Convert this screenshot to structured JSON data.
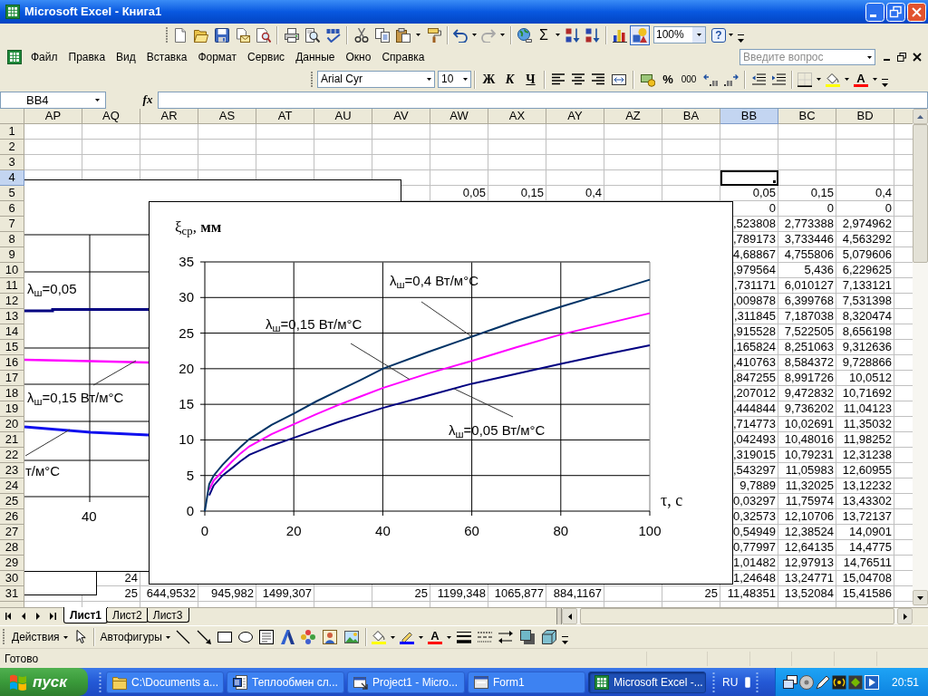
{
  "window": {
    "title": "Microsoft Excel - Книга1"
  },
  "standard_toolbar": {
    "autosum": "Σ",
    "zoom": "100%",
    "help": "?",
    "drawing_button": {
      "on": true
    }
  },
  "menu": [
    "Файл",
    "Правка",
    "Вид",
    "Вставка",
    "Формат",
    "Сервис",
    "Данные",
    "Окно",
    "Справка"
  ],
  "help_box": {
    "placeholder": "Введите вопрос"
  },
  "formatting_toolbar": {
    "font": "Arial Cyr",
    "size": "10",
    "bold": "Ж",
    "italic": "К",
    "underline": "Ч",
    "percent": "%",
    "thousands": "000",
    "font_color": "A"
  },
  "formula_bar": {
    "name_box": "BB4",
    "function_label": "fx"
  },
  "sheet": {
    "columns": [
      {
        "label": "AP",
        "selected": false
      },
      {
        "label": "AQ",
        "selected": false
      },
      {
        "label": "AR",
        "selected": false
      },
      {
        "label": "AS",
        "selected": false
      },
      {
        "label": "AT",
        "selected": false
      },
      {
        "label": "AU",
        "selected": false
      },
      {
        "label": "AV",
        "selected": false
      },
      {
        "label": "AW",
        "selected": false
      },
      {
        "label": "AX",
        "selected": false
      },
      {
        "label": "AY",
        "selected": false
      },
      {
        "label": "AZ",
        "selected": false
      },
      {
        "label": "BA",
        "selected": false
      },
      {
        "label": "BB",
        "selected": true
      },
      {
        "label": "BC",
        "selected": false
      },
      {
        "label": "BD",
        "selected": false
      }
    ],
    "rows": [
      {
        "label": "1",
        "selected": false
      },
      {
        "label": "2",
        "selected": false
      },
      {
        "label": "3",
        "selected": false
      },
      {
        "label": "4",
        "selected": true
      },
      {
        "label": "5",
        "selected": false,
        "cells": [
          null,
          null,
          null,
          null,
          null,
          null,
          null,
          "0,05",
          "0,15",
          "0,4",
          null,
          null,
          "0,05",
          "0,15",
          "0,4"
        ]
      },
      {
        "label": "6",
        "selected": false,
        "cells": [
          null,
          null,
          null,
          null,
          null,
          null,
          null,
          null,
          null,
          null,
          null,
          null,
          "0",
          "0",
          "0"
        ]
      },
      {
        "label": "7",
        "selected": false,
        "cells": [
          null,
          null,
          null,
          null,
          null,
          null,
          null,
          null,
          null,
          null,
          null,
          null,
          ",523808",
          "2,773388",
          "2,974962"
        ]
      },
      {
        "label": "8",
        "selected": false,
        "cells": [
          null,
          null,
          null,
          null,
          null,
          null,
          null,
          null,
          null,
          null,
          null,
          null,
          ",789173",
          "3,733446",
          "4,563292"
        ]
      },
      {
        "label": "9",
        "selected": false,
        "cells": [
          null,
          null,
          null,
          null,
          null,
          null,
          null,
          null,
          null,
          null,
          null,
          null,
          "4,68867",
          "4,755806",
          "5,079606"
        ]
      },
      {
        "label": "10",
        "selected": false,
        "cells": [
          null,
          null,
          null,
          null,
          null,
          null,
          null,
          null,
          null,
          null,
          null,
          null,
          ",979564",
          "5,436",
          "6,229625"
        ]
      },
      {
        "label": "11",
        "selected": false,
        "cells": [
          null,
          null,
          null,
          null,
          null,
          null,
          null,
          null,
          null,
          null,
          null,
          null,
          ",731171",
          "6,010127",
          "7,133121"
        ]
      },
      {
        "label": "12",
        "selected": false,
        "cells": [
          null,
          null,
          null,
          null,
          null,
          null,
          null,
          null,
          null,
          null,
          null,
          null,
          ",009878",
          "6,399768",
          "7,531398"
        ]
      },
      {
        "label": "13",
        "selected": false,
        "cells": [
          null,
          null,
          null,
          null,
          null,
          null,
          null,
          null,
          null,
          null,
          null,
          null,
          ",311845",
          "7,187038",
          "8,320474"
        ]
      },
      {
        "label": "14",
        "selected": false,
        "cells": [
          null,
          null,
          null,
          null,
          null,
          null,
          null,
          null,
          null,
          null,
          null,
          null,
          ",915528",
          "7,522505",
          "8,656198"
        ]
      },
      {
        "label": "15",
        "selected": false,
        "cells": [
          null,
          null,
          null,
          null,
          null,
          null,
          null,
          null,
          null,
          null,
          null,
          null,
          ",165824",
          "8,251063",
          "9,312636"
        ]
      },
      {
        "label": "16",
        "selected": false,
        "cells": [
          null,
          null,
          null,
          null,
          null,
          null,
          null,
          null,
          null,
          null,
          null,
          null,
          ",410763",
          "8,584372",
          "9,728866"
        ]
      },
      {
        "label": "17",
        "selected": false,
        "cells": [
          null,
          null,
          null,
          null,
          null,
          null,
          null,
          null,
          null,
          null,
          null,
          null,
          ",847255",
          "8,991726",
          "10,0512"
        ]
      },
      {
        "label": "18",
        "selected": false,
        "cells": [
          null,
          null,
          null,
          null,
          null,
          null,
          null,
          null,
          null,
          null,
          null,
          null,
          ",207012",
          "9,472832",
          "10,71692"
        ]
      },
      {
        "label": "19",
        "selected": false,
        "cells": [
          null,
          null,
          null,
          null,
          null,
          null,
          null,
          null,
          null,
          null,
          null,
          null,
          ",444844",
          "9,736202",
          "11,04123"
        ]
      },
      {
        "label": "20",
        "selected": false,
        "cells": [
          null,
          null,
          null,
          null,
          null,
          null,
          null,
          null,
          null,
          null,
          null,
          null,
          ",714773",
          "10,02691",
          "11,35032"
        ]
      },
      {
        "label": "21",
        "selected": false,
        "cells": [
          null,
          null,
          null,
          null,
          null,
          null,
          null,
          null,
          null,
          null,
          null,
          null,
          ",042493",
          "10,48016",
          "11,98252"
        ]
      },
      {
        "label": "22",
        "selected": false,
        "cells": [
          null,
          null,
          null,
          null,
          null,
          null,
          null,
          null,
          null,
          null,
          null,
          null,
          ",319015",
          "10,79231",
          "12,31238"
        ]
      },
      {
        "label": "23",
        "selected": false,
        "cells": [
          null,
          null,
          null,
          null,
          null,
          null,
          null,
          null,
          null,
          null,
          null,
          null,
          ",543297",
          "11,05983",
          "12,60955"
        ]
      },
      {
        "label": "24",
        "selected": false,
        "cells": [
          null,
          null,
          null,
          null,
          null,
          null,
          null,
          null,
          null,
          null,
          null,
          null,
          "9,7889",
          "11,32025",
          "13,12232"
        ]
      },
      {
        "label": "25",
        "selected": false,
        "cells": [
          null,
          null,
          null,
          null,
          null,
          null,
          null,
          null,
          null,
          null,
          null,
          null,
          "0,03297",
          "11,75974",
          "13,43302"
        ]
      },
      {
        "label": "26",
        "selected": false,
        "cells": [
          null,
          null,
          null,
          null,
          null,
          null,
          null,
          null,
          null,
          null,
          null,
          null,
          "0,32573",
          "12,10706",
          "13,72137"
        ]
      },
      {
        "label": "27",
        "selected": false,
        "cells": [
          null,
          null,
          null,
          null,
          null,
          null,
          null,
          null,
          null,
          null,
          null,
          null,
          "0,54949",
          "12,38524",
          "14,0901"
        ]
      },
      {
        "label": "28",
        "selected": false,
        "cells": [
          null,
          null,
          null,
          null,
          null,
          null,
          null,
          null,
          null,
          null,
          null,
          null,
          "0,77997",
          "12,64135",
          "14,4775"
        ]
      },
      {
        "label": "29",
        "selected": false,
        "cells": [
          null,
          null,
          null,
          null,
          null,
          null,
          null,
          null,
          null,
          null,
          null,
          null,
          "1,01482",
          "12,97913",
          "14,76511"
        ]
      },
      {
        "label": "30",
        "selected": false,
        "cells": [
          null,
          "24",
          null,
          null,
          null,
          null,
          null,
          null,
          null,
          null,
          null,
          null,
          "1,24648",
          "13,24771",
          "15,04708"
        ]
      },
      {
        "label": "31",
        "selected": false,
        "cells": [
          null,
          "25",
          "644,9532",
          "945,982",
          "1499,307",
          null,
          "25",
          "1199,348",
          "1065,877",
          "884,1167",
          null,
          "25",
          "11,48351",
          "13,52084",
          "15,41586"
        ]
      }
    ]
  },
  "background_chart": {
    "labels": [
      "λ$_{ш}$=0,05",
      "λ$_{ш}$=0,15 Вт/м°С",
      "т/м°С"
    ],
    "tick_label": "40"
  },
  "chart": {
    "chart_data": {
      "type": "line",
      "xlabel": "τ, с",
      "ylabel": "ξ$_{ср}$, **мм**",
      "x": [
        0,
        1,
        2,
        4,
        6,
        8,
        10,
        15,
        20,
        25,
        30,
        35,
        40,
        50,
        60,
        70,
        80,
        90,
        100
      ],
      "series": [
        {
          "color": "#000080",
          "values": [
            null,
            2.2,
            3.6,
            5.0,
            6.0,
            7.0,
            7.9,
            9.2,
            10.3,
            11.4,
            12.5,
            13.5,
            14.5,
            16.2,
            17.9,
            19.3,
            20.7,
            22.0,
            23.3
          ]
        },
        {
          "color": "#ff00ff",
          "values": [
            null,
            3.0,
            4.3,
            5.6,
            6.9,
            8.1,
            9.1,
            10.8,
            12.2,
            13.6,
            14.9,
            16.1,
            17.3,
            19.3,
            21.1,
            23.0,
            24.8,
            26.3,
            27.8
          ]
        },
        {
          "color": "#003366",
          "values": [
            0,
            3.8,
            5.0,
            6.5,
            7.8,
            9.0,
            10.1,
            12.1,
            13.7,
            15.4,
            16.9,
            18.4,
            20.0,
            22.3,
            24.5,
            26.7,
            28.7,
            30.6,
            32.5
          ]
        }
      ],
      "xlim": [
        0,
        100
      ],
      "ylim": [
        0,
        35
      ],
      "xticks": [
        0,
        20,
        40,
        60,
        80,
        100
      ],
      "yticks": [
        0,
        5,
        10,
        15,
        20,
        25,
        30,
        35
      ],
      "grid": true,
      "annotations": [
        {
          "text": "λ$_{ш}$=0,4 Вт/м°С",
          "x": 60,
          "y": 24.5
        },
        {
          "text": "λ$_{ш}$=0,15 Вт/м°С",
          "x": 46,
          "y": 18.5
        },
        {
          "text": "λ$_{ш}$=0,05 Вт/м°С",
          "x": 56,
          "y": 17.2
        }
      ]
    }
  },
  "sheet_tabs": [
    {
      "label": "Лист1",
      "selected": true
    },
    {
      "label": "Лист2",
      "selected": false
    },
    {
      "label": "Лист3",
      "selected": false
    }
  ],
  "drawing_toolbar": {
    "actions": "Действия",
    "autoshapes": "Автофигуры",
    "font_color": "A"
  },
  "status_bar": {
    "text": "Готово"
  },
  "taskbar": {
    "start": "пуск",
    "tasks": [
      {
        "label": "C:\\Documents a...",
        "kind": "folder",
        "selected": false
      },
      {
        "label": "Теплообмен сл...",
        "kind": "document",
        "selected": false
      },
      {
        "label": "Project1 - Micro...",
        "kind": "project",
        "selected": false
      },
      {
        "label": "Form1",
        "kind": "form",
        "selected": false
      },
      {
        "label": "Microsoft Excel -...",
        "kind": "spreadsheet",
        "selected": true
      }
    ],
    "language": "RU",
    "clock": "20:51"
  }
}
